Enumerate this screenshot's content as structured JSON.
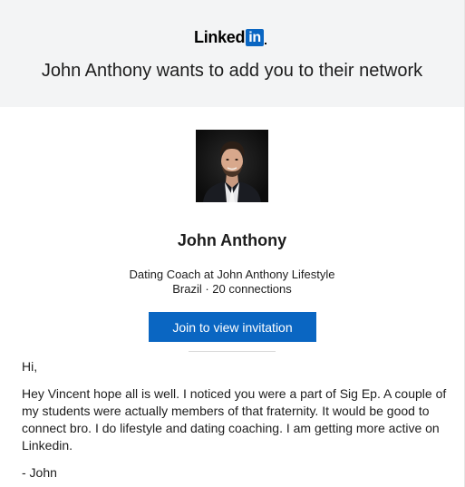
{
  "header": {
    "logo": {
      "text": "Linked",
      "box_text": "in",
      "brand_color": "#0a66c2"
    },
    "title": "John Anthony wants to add you to their network"
  },
  "profile": {
    "avatar_icon": "profile-photo",
    "name": "John Anthony",
    "headline": "Dating Coach at John Anthony Lifestyle",
    "meta": "Brazil · 20 connections"
  },
  "actions": {
    "join_label": "Join to view invitation"
  },
  "message": {
    "greeting": "Hi,",
    "body": "Hey Vincent hope all is well. I noticed you were a part of Sig Ep. A couple of my students were actually members of that fraternity. It would be good to connect bro. I do lifestyle and dating coaching. I am getting more active on Linkedin.",
    "signoff": "- John"
  }
}
